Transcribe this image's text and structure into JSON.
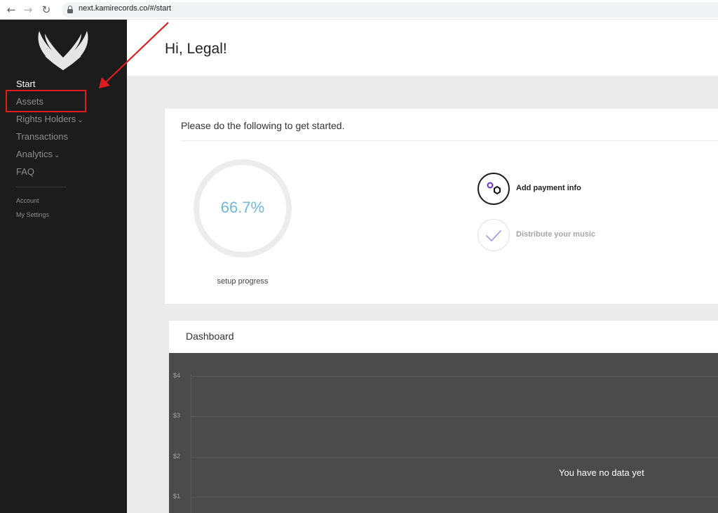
{
  "browser": {
    "url": "next.kamirecords.co/#/start",
    "back_icon": "back-arrow-icon",
    "forward_icon": "forward-arrow-icon",
    "reload_icon": "reload-icon",
    "lock_icon": "lock-icon"
  },
  "sidebar": {
    "logo_icon": "wings-logo-icon",
    "items": [
      {
        "label": "Start"
      },
      {
        "label": "Assets"
      },
      {
        "label": "Rights Holders"
      },
      {
        "label": "Transactions"
      },
      {
        "label": "Analytics"
      },
      {
        "label": "FAQ"
      }
    ],
    "sub_items": [
      {
        "label": "Account"
      },
      {
        "label": "My Settings"
      }
    ]
  },
  "header": {
    "greeting": "Hi, Legal!"
  },
  "setup": {
    "instructions": "Please do the following to get started.",
    "progress_text": "66.7%",
    "progress_value": 66.7,
    "progress_label": "setup progress",
    "steps": [
      {
        "label": "Add payment info",
        "icon": "payment-shapes-icon",
        "done": false
      },
      {
        "label": "Distribute your music",
        "icon": "checkmark-icon",
        "done": true
      }
    ]
  },
  "dashboard": {
    "title": "Dashboard",
    "empty_message": "You have no data yet",
    "y_ticks": [
      "$4",
      "$3",
      "$2",
      "$1"
    ]
  },
  "colors": {
    "sidebar_bg": "#1c1c1c",
    "progress_accent": "#6fb8d8",
    "annotation_red": "#e01d1d",
    "chart_bg": "#4b4b4b"
  }
}
